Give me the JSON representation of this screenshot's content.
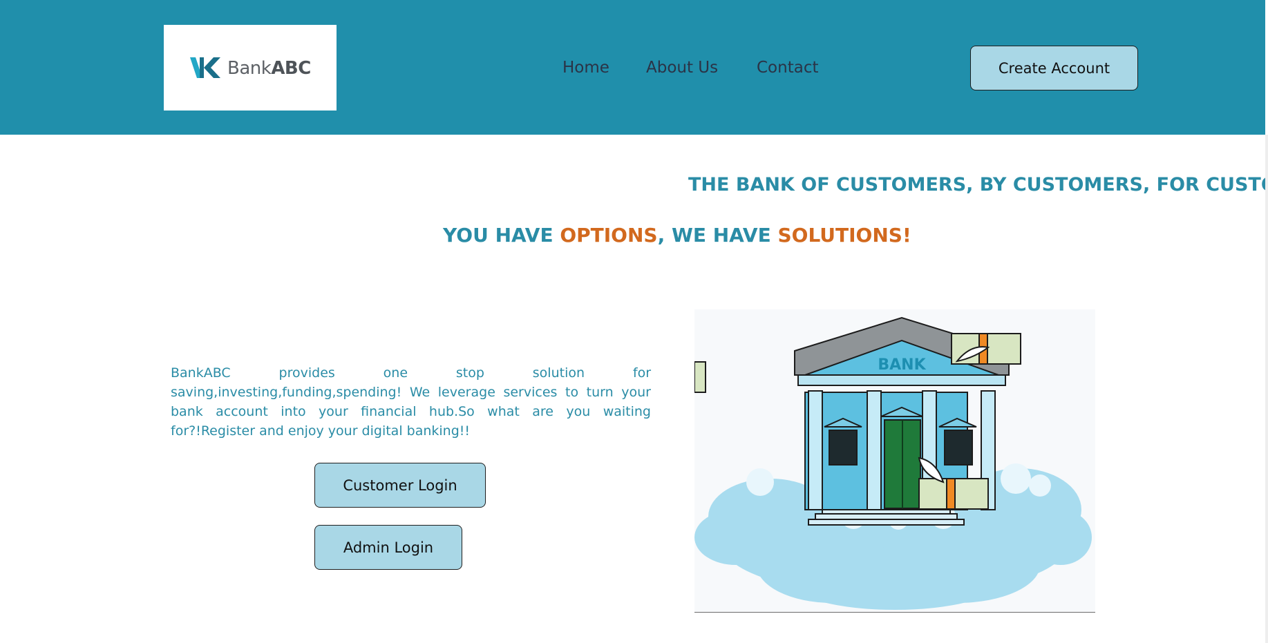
{
  "colors": {
    "header_bg": "#208fab",
    "accent_blue": "#2a8ca6",
    "accent_orange": "#d2691e",
    "button_bg": "#a9d7e6",
    "nav_text": "#2b3346"
  },
  "header": {
    "logo": {
      "brand_part1": "Bank",
      "brand_part2": "ABC",
      "icon": "bank-abc-logo-icon"
    },
    "nav": {
      "home": "Home",
      "about": "About Us",
      "contact": "Contact"
    },
    "create_account_label": "Create Account"
  },
  "hero": {
    "marquee_text": "THE BANK OF CUSTOMERS, BY CUSTOMERS, FOR CUSTOMERS",
    "tagline": {
      "part1": "YOU HAVE ",
      "part2": "OPTIONS",
      "part3": ", WE HAVE ",
      "part4": "SOLUTIONS!"
    }
  },
  "intro": {
    "text": "BankABC provides one stop solution for saving,investing,funding,spending! We leverage services to turn your bank account into your financial hub.So what are you waiting for?!Register and enjoy your digital banking!!"
  },
  "actions": {
    "customer_login_label": "Customer Login",
    "admin_login_label": "Admin Login"
  },
  "illustration": {
    "building_sign": "BANK",
    "icon": "bank-on-cloud-illustration"
  }
}
